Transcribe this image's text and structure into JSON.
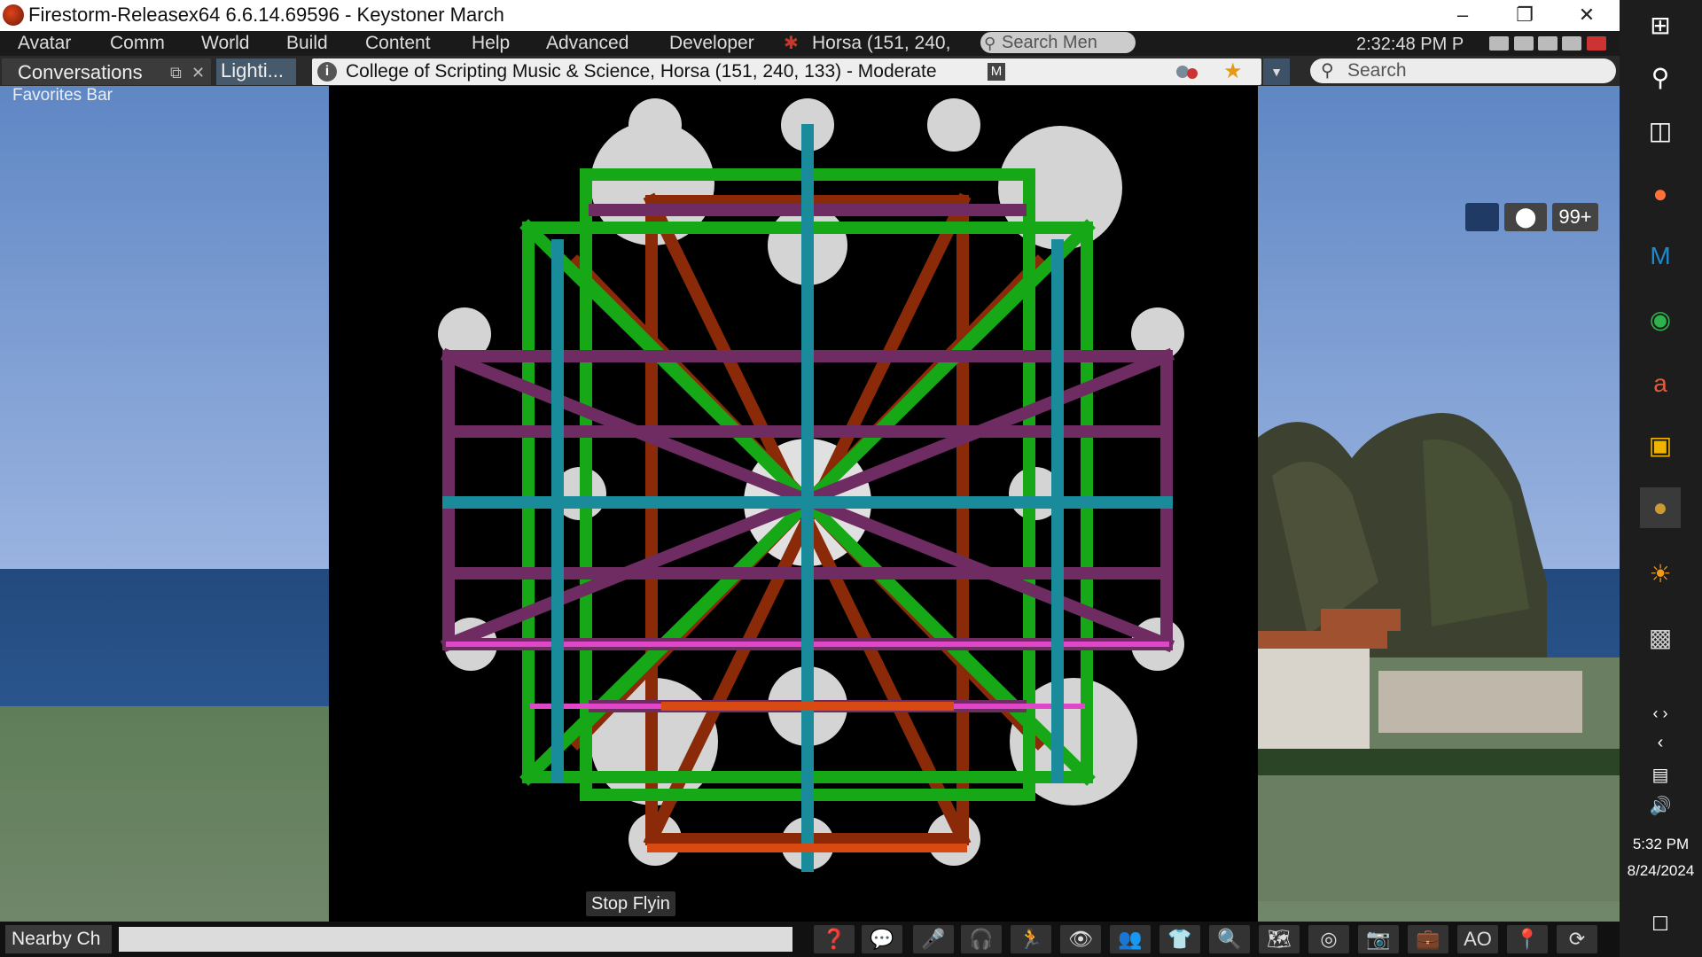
{
  "window": {
    "title": "Firestorm-Releasex64 6.6.14.69596 - Keystoner March",
    "controls": [
      "–",
      "❐",
      "✕"
    ]
  },
  "menu": {
    "items": [
      "Avatar",
      "Comm",
      "World",
      "Build",
      "Content",
      "Help",
      "Advanced",
      "Developer"
    ],
    "location_short": "Horsa (151, 240,",
    "search_placeholder": "Search Men",
    "clock": "2:32:48 PM P"
  },
  "nav": {
    "tab_conversations": "Conversations",
    "tab_lighting": "Lighti...",
    "location": "College of Scripting Music & Science, Horsa (151, 240, 133) - Moderate",
    "maturity_badge": "M",
    "search_placeholder": "Search"
  },
  "scene": {
    "favorites_bar": "Favorites Bar",
    "notifications_count": "99+",
    "stop_flying": "Stop Flyin"
  },
  "bottom": {
    "nearby_chat": "Nearby Ch",
    "ao_label": "AO"
  },
  "taskbar": {
    "time": "5:32 PM",
    "date": "8/24/2024"
  },
  "colors": {
    "orange_struts": "#8a2a08",
    "green_struts": "#16a816",
    "purple_struts": "#6e2c62",
    "teal_struts": "#1a8b9a",
    "spheres": "#cfcfcf"
  }
}
